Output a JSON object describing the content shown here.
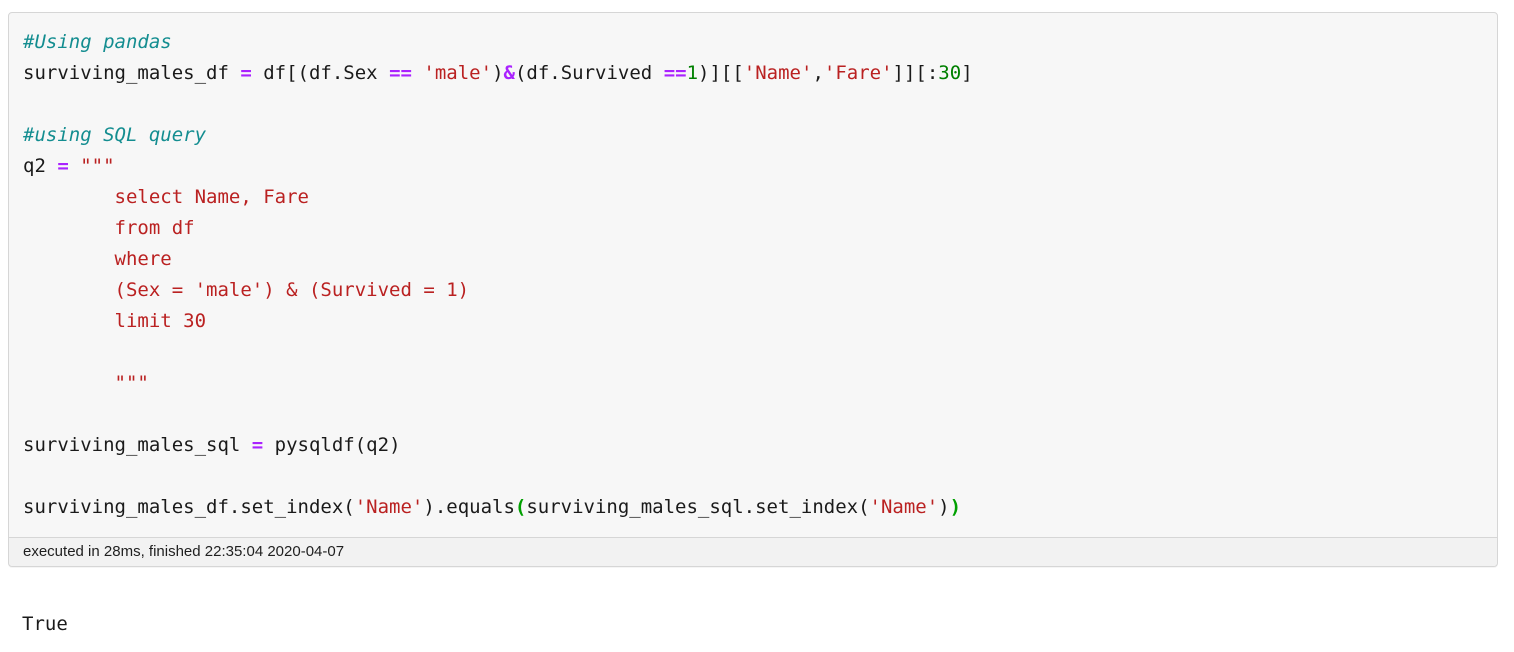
{
  "cell": {
    "code_lines": [
      [
        {
          "t": "comment",
          "s": "#Using pandas"
        }
      ],
      [
        {
          "t": "plain",
          "s": "surviving_males_df "
        },
        {
          "t": "op",
          "s": "="
        },
        {
          "t": "plain",
          "s": " df[(df.Sex "
        },
        {
          "t": "op",
          "s": "=="
        },
        {
          "t": "plain",
          "s": " "
        },
        {
          "t": "str",
          "s": "'male'"
        },
        {
          "t": "plain",
          "s": ")"
        },
        {
          "t": "op",
          "s": "&"
        },
        {
          "t": "plain",
          "s": "(df.Survived "
        },
        {
          "t": "op",
          "s": "=="
        },
        {
          "t": "num",
          "s": "1"
        },
        {
          "t": "plain",
          "s": ")][["
        },
        {
          "t": "str",
          "s": "'Name'"
        },
        {
          "t": "plain",
          "s": ","
        },
        {
          "t": "str",
          "s": "'Fare'"
        },
        {
          "t": "plain",
          "s": "]][:"
        },
        {
          "t": "num",
          "s": "30"
        },
        {
          "t": "plain",
          "s": "]"
        }
      ],
      [
        {
          "t": "plain",
          "s": ""
        }
      ],
      [
        {
          "t": "comment",
          "s": "#using SQL query"
        }
      ],
      [
        {
          "t": "plain",
          "s": "q2 "
        },
        {
          "t": "op",
          "s": "="
        },
        {
          "t": "plain",
          "s": " "
        },
        {
          "t": "str",
          "s": "\"\"\""
        }
      ],
      [
        {
          "t": "str",
          "s": "        select Name, Fare"
        }
      ],
      [
        {
          "t": "str",
          "s": "        from df"
        }
      ],
      [
        {
          "t": "str",
          "s": "        where"
        }
      ],
      [
        {
          "t": "str",
          "s": "        (Sex = 'male') & (Survived = 1)"
        }
      ],
      [
        {
          "t": "str",
          "s": "        limit 30"
        }
      ],
      [
        {
          "t": "plain",
          "s": ""
        }
      ],
      [
        {
          "t": "str",
          "s": "        \"\"\""
        }
      ],
      [
        {
          "t": "plain",
          "s": ""
        }
      ],
      [
        {
          "t": "plain",
          "s": "surviving_males_sql "
        },
        {
          "t": "op",
          "s": "="
        },
        {
          "t": "plain",
          "s": " pysqldf(q2)"
        }
      ],
      [
        {
          "t": "plain",
          "s": ""
        }
      ],
      [
        {
          "t": "plain",
          "s": "surviving_males_df.set_index("
        },
        {
          "t": "str",
          "s": "'Name'"
        },
        {
          "t": "plain",
          "s": ").equals"
        },
        {
          "t": "match",
          "s": "("
        },
        {
          "t": "plain",
          "s": "surviving_males_sql.set_index("
        },
        {
          "t": "str",
          "s": "'Name'"
        },
        {
          "t": "plain",
          "s": ")"
        },
        {
          "t": "match",
          "s": ")"
        }
      ]
    ],
    "footer_status": "executed in 28ms, finished 22:35:04 2020-04-07"
  },
  "output": {
    "text": "True"
  },
  "colors": {
    "comment": "#138d90",
    "operator": "#aa22ff",
    "string": "#ba2121",
    "number": "#008000",
    "bracket_match": "#00a000",
    "cell_background": "#f7f7f7",
    "cell_border": "#d6d6d6",
    "footer_background": "#f2f2f2",
    "page_background": "#ffffff"
  }
}
